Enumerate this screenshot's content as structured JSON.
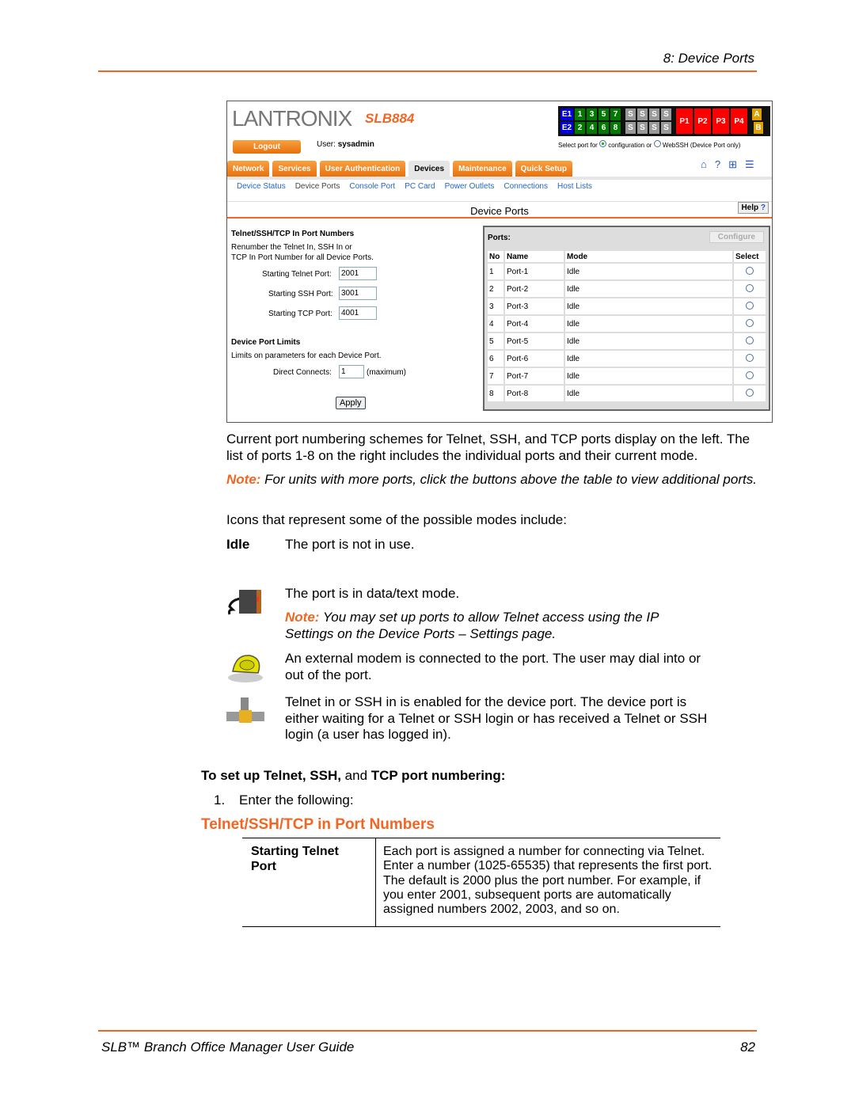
{
  "header": {
    "chapter": "8: Device Ports"
  },
  "screenshot": {
    "logo": "LANTRONIX",
    "model": "SLB884",
    "port_panel": {
      "row1": [
        "E1",
        "1",
        "3",
        "5",
        "7",
        "S",
        "S",
        "S",
        "S",
        "P1",
        "P2",
        "P3",
        "P4",
        "A"
      ],
      "row2": [
        "E2",
        "2",
        "4",
        "6",
        "8",
        "S",
        "S",
        "S",
        "S",
        "B"
      ]
    },
    "logout": "Logout",
    "user_label": "User:",
    "user": "sysadmin",
    "select_port_for": "Select port for",
    "opt_config": "configuration or",
    "opt_webssh": "WebSSH (Device Port only)",
    "tabs": [
      "Network",
      "Services",
      "User Authentication",
      "Devices",
      "Maintenance",
      "Quick Setup"
    ],
    "subnav": [
      "Device Status",
      "Device Ports",
      "Console Port",
      "PC Card",
      "Power Outlets",
      "Connections",
      "Host Lists"
    ],
    "title": "Device Ports",
    "help": "Help",
    "left": {
      "h1": "Telnet/SSH/TCP In Port Numbers",
      "desc1": "Renumber the Telnet In, SSH In or",
      "desc2": "TCP In Port Number for all Device Ports.",
      "telnet_label": "Starting Telnet Port:",
      "telnet": "2001",
      "ssh_label": "Starting SSH Port:",
      "ssh": "3001",
      "tcp_label": "Starting TCP Port:",
      "tcp": "4001",
      "h2": "Device Port Limits",
      "desc3": "Limits on parameters for each Device Port.",
      "dc_label": "Direct Connects:",
      "dc": "1",
      "dc_suffix": "(maximum)",
      "apply": "Apply"
    },
    "ports": {
      "title": "Ports:",
      "configure": "Configure",
      "cols": [
        "No",
        "Name",
        "Mode",
        "Select"
      ],
      "rows": [
        [
          "1",
          "Port-1",
          "Idle"
        ],
        [
          "2",
          "Port-2",
          "Idle"
        ],
        [
          "3",
          "Port-3",
          "Idle"
        ],
        [
          "4",
          "Port-4",
          "Idle"
        ],
        [
          "5",
          "Port-5",
          "Idle"
        ],
        [
          "6",
          "Port-6",
          "Idle"
        ],
        [
          "7",
          "Port-7",
          "Idle"
        ],
        [
          "8",
          "Port-8",
          "Idle"
        ]
      ]
    }
  },
  "body": {
    "p1": "Current port numbering schemes for Telnet, SSH, and TCP ports display on the left. The list of ports 1-8 on the right includes the individual ports and their current mode.",
    "note_label": "Note:",
    "note1": " For units with more ports, click the buttons above the table to view additional ports.",
    "icons_intro": "Icons that represent some of the possible modes include:",
    "idle_term": "Idle",
    "idle_desc": "The port is not in use.",
    "data_desc": "The port is in data/text mode.",
    "note2": " You may set up ports to allow Telnet access using the IP Settings on the Device Ports – Settings page.",
    "modem_desc": "An external modem is connected to the port. The user may dial into or out of the port.",
    "telnet_desc": "Telnet in or SSH in is enabled for the device port. The device port is either waiting for a Telnet or SSH login or has received a Telnet or SSH login (a user has logged in).",
    "setup_heading_a": "To set up Telnet, SSH,",
    "setup_heading_b": " and ",
    "setup_heading_c": "TCP port numbering:",
    "step_num": "1.",
    "step": "Enter the following:",
    "section": "Telnet/SSH/TCP in Port Numbers",
    "table": {
      "term": "Starting Telnet Port",
      "desc": "Each port is assigned a number for connecting via Telnet. Enter a number (1025-65535) that represents the first port. The default is 2000 plus the port number. For example, if you enter 2001, subsequent ports are automatically assigned numbers 2002, 2003, and so on."
    }
  },
  "footer": {
    "title": "SLB™ Branch Office Manager User Guide",
    "page": "82"
  },
  "colors": {
    "accent": "#f26522"
  }
}
